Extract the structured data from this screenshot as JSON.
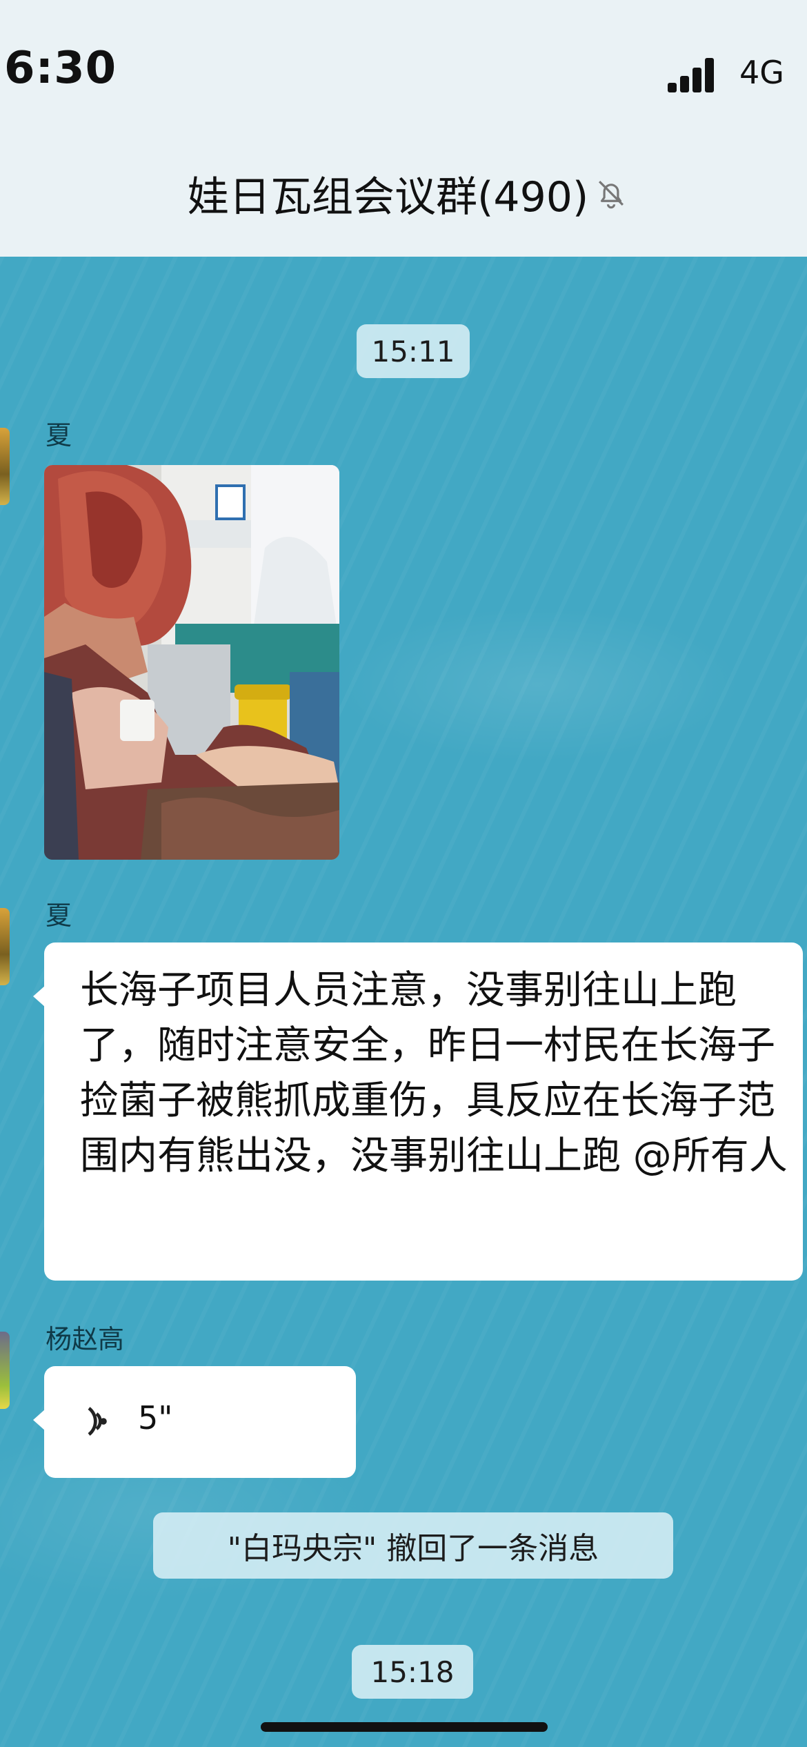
{
  "status_bar": {
    "time": "6:30",
    "network": "4G"
  },
  "header": {
    "title": "娃日瓦组会议群(490)",
    "mute_icon": "bell-slash-icon"
  },
  "messages": {
    "timestamp_1": "15:11",
    "image_message": {
      "sender": "夏"
    },
    "text_message": {
      "sender": "夏",
      "text": "长海子项目人员注意，没事别往山上跑了，随时注意安全，昨日一村民在长海子捡菌子被熊抓成重伤，具反应在长海子范围内有熊出没，没事别往山上跑 @所有人"
    },
    "voice_message": {
      "sender": "杨赵高",
      "duration": "5\""
    },
    "recall_notice": "\"白玛央宗\" 撤回了一条消息",
    "timestamp_2": "15:18"
  },
  "colors": {
    "chat_background": "#42a8c4",
    "header_background": "#eaf2f5",
    "bubble": "#ffffff"
  }
}
